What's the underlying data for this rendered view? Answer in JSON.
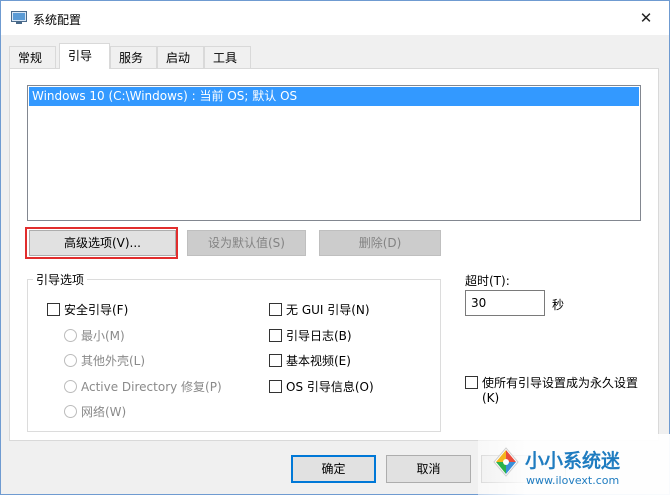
{
  "window": {
    "title": "系统配置",
    "close_glyph": "✕"
  },
  "tabs": [
    {
      "label": "常规"
    },
    {
      "label": "引导"
    },
    {
      "label": "服务"
    },
    {
      "label": "启动"
    },
    {
      "label": "工具"
    }
  ],
  "os_list": {
    "items": [
      "Windows 10 (C:\\Windows) : 当前 OS; 默认 OS"
    ]
  },
  "buttons": {
    "advanced": "高级选项(V)...",
    "set_default": "设为默认值(S)",
    "delete": "删除(D)",
    "ok": "确定",
    "cancel": "取消"
  },
  "boot_options": {
    "title": "引导选项",
    "safe_boot": "安全引导(F)",
    "radios": [
      "最小(M)",
      "其他外壳(L)",
      "Active Directory 修复(P)",
      "网络(W)"
    ],
    "no_gui": "无 GUI 引导(N)",
    "boot_log": "引导日志(B)",
    "base_video": "基本视频(E)",
    "os_boot_info": "OS 引导信息(O)"
  },
  "timeout": {
    "label": "超时(T):",
    "value": "30",
    "unit": "秒"
  },
  "permanent": {
    "line1": "使所有引导设置成为永久设置",
    "line2": "(K)"
  },
  "watermark": {
    "name": "小小系统迷",
    "url": "www.ilovext.com"
  },
  "colors": {
    "selection": "#3399ff",
    "highlight_border": "#e12d2d",
    "default_button": "#0078d7"
  }
}
